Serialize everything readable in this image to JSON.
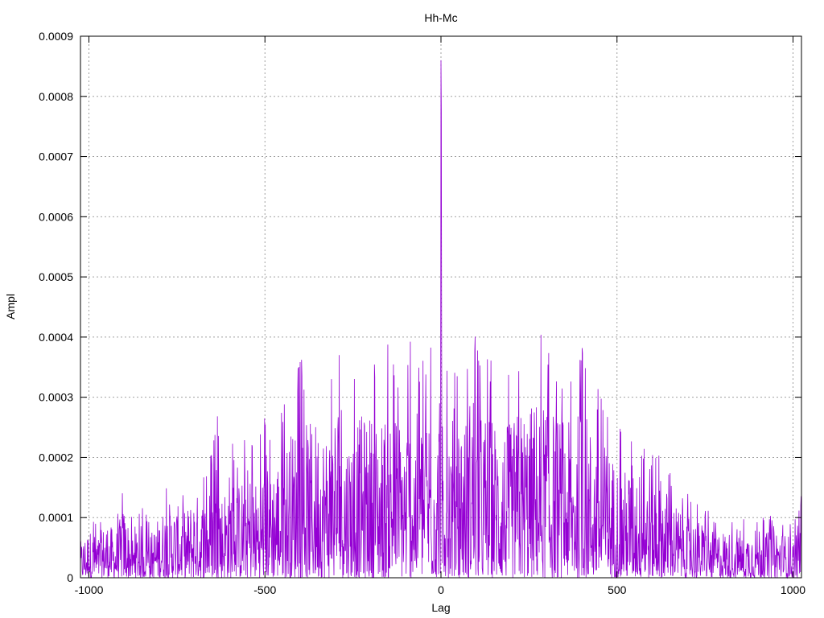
{
  "chart_data": {
    "type": "line",
    "title": "Hh-Mc",
    "xlabel": "Lag",
    "ylabel": "Ampl",
    "xlim": [
      -1024,
      1024
    ],
    "ylim": [
      0,
      0.0009
    ],
    "grid": true,
    "xticks": [
      -1000,
      -500,
      0,
      500,
      1000
    ],
    "xtick_labels": [
      "-1000",
      "-500",
      "0",
      "500",
      "1000"
    ],
    "yticks": [
      0,
      0.0001,
      0.0002,
      0.0003,
      0.0004,
      0.0005,
      0.0006,
      0.0007,
      0.0008,
      0.0009
    ],
    "ytick_labels": [
      "0",
      "0.0001",
      "0.0002",
      "0.0003",
      "0.0004",
      "0.0005",
      "0.0006",
      "0.0007",
      "0.0008",
      "0.0009"
    ],
    "series": [
      {
        "color": "#9400d3",
        "x": [
          -1024,
          -1000,
          -975,
          -950,
          -925,
          -900,
          -875,
          -850,
          -825,
          -800,
          -775,
          -750,
          -725,
          -700,
          -675,
          -650,
          -635,
          -625,
          -600,
          -575,
          -550,
          -525,
          -500,
          -485,
          -475,
          -450,
          -425,
          -400,
          -375,
          -350,
          -325,
          -300,
          -285,
          -275,
          -250,
          -225,
          -200,
          -175,
          -150,
          -125,
          -100,
          -90,
          -75,
          -50,
          -25,
          -10,
          -5,
          0,
          5,
          10,
          25,
          50,
          75,
          90,
          100,
          125,
          150,
          175,
          200,
          225,
          250,
          275,
          300,
          325,
          350,
          375,
          400,
          425,
          450,
          475,
          500,
          525,
          550,
          575,
          600,
          610,
          625,
          650,
          675,
          700,
          725,
          750,
          775,
          800,
          825,
          850,
          875,
          900,
          925,
          950,
          975,
          1000,
          1010,
          1024
        ],
        "y": [
          8e-05,
          0.00011,
          9e-05,
          0.00013,
          0.0001,
          0.00016,
          9e-05,
          0.00012,
          0.0001,
          0.00014,
          0.00017,
          0.00016,
          0.00015,
          0.00019,
          0.00018,
          0.00021,
          0.00031,
          0.00019,
          0.00024,
          0.00021,
          0.00025,
          0.00022,
          0.00027,
          0.00034,
          0.00026,
          0.0003,
          0.00033,
          0.00037,
          0.00034,
          0.00036,
          0.00034,
          0.00039,
          0.00045,
          0.00033,
          0.00034,
          0.00036,
          0.00037,
          0.00035,
          0.00039,
          0.00037,
          0.00034,
          0.00041,
          0.00036,
          0.00038,
          0.00041,
          0.00035,
          0.00041,
          0.00086,
          0.00045,
          0.00042,
          0.00038,
          0.00039,
          0.00036,
          0.00047,
          0.00038,
          0.00037,
          0.00036,
          0.00035,
          0.00034,
          0.00039,
          0.00038,
          0.00041,
          0.0004,
          0.00037,
          0.00036,
          0.00033,
          0.0004,
          0.00034,
          0.00031,
          0.00029,
          0.00026,
          0.00024,
          0.00027,
          0.00022,
          0.00028,
          0.00021,
          0.00023,
          0.00018,
          0.00016,
          0.00014,
          0.00013,
          0.00012,
          0.0001,
          0.00011,
          0.0001,
          9e-05,
          0.00011,
          0.00013,
          0.0001,
          0.00012,
          0.0001,
          9e-05,
          0.00011,
          0.00014
        ]
      }
    ]
  }
}
